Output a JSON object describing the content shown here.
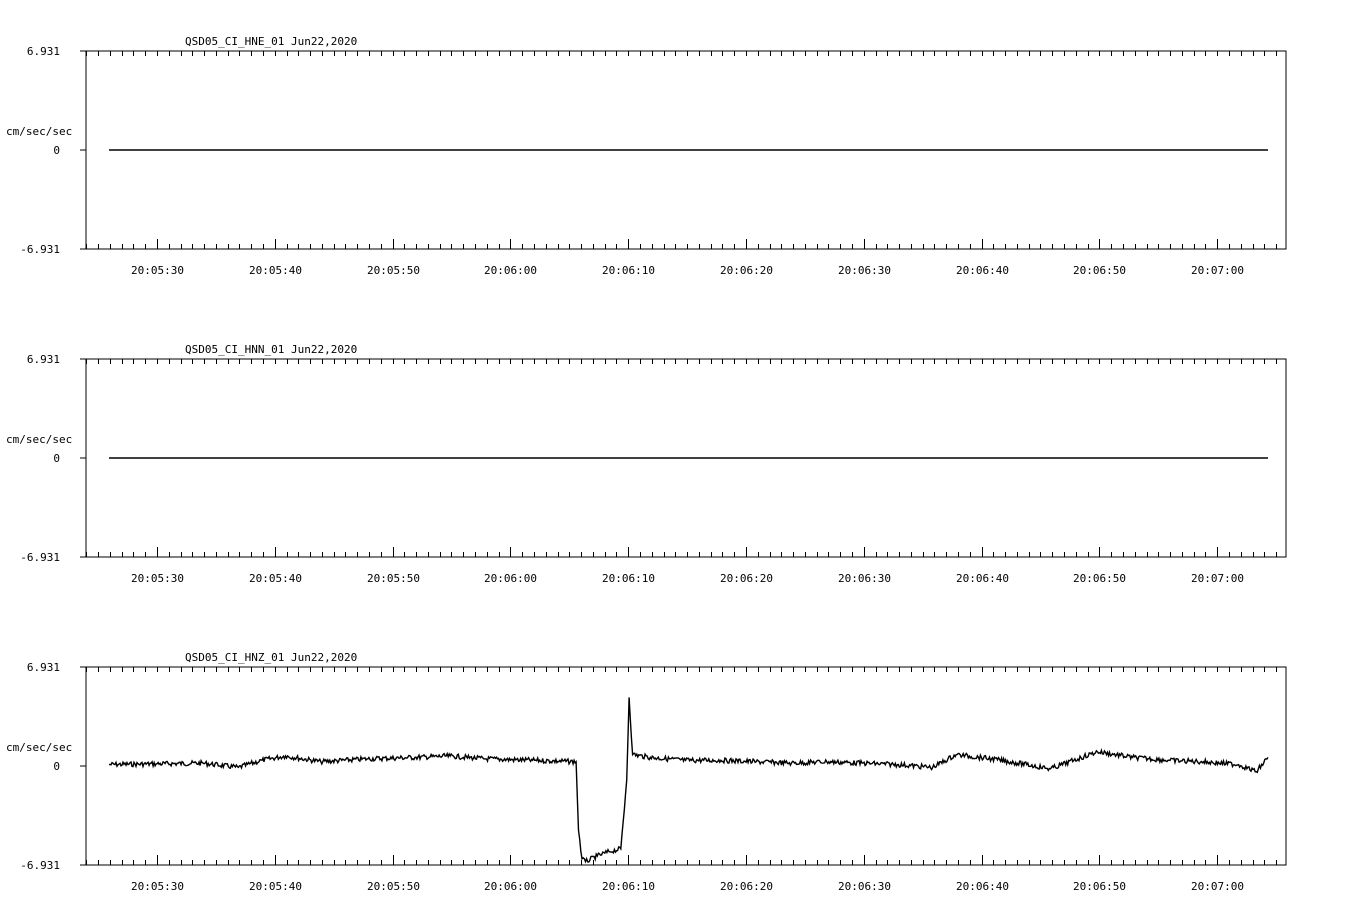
{
  "page": {
    "background": "#ffffff",
    "trace_color": "#000000"
  },
  "chart_data": [
    {
      "type": "line",
      "title": "QSD05_CI_HNE_01  Jun22,2020",
      "ylabel": "cm/sec/sec",
      "ylim": [
        -6.931,
        6.931
      ],
      "yticks": [
        "6.931",
        "0",
        "-6.931"
      ],
      "xlabels": [
        "20:05:30",
        "20:05:40",
        "20:05:50",
        "20:06:00",
        "20:06:10",
        "20:06:20",
        "20:06:30",
        "20:06:40",
        "20:06:50",
        "20:07:00"
      ],
      "x_start": "20:05:26",
      "x_end": "20:07:04.5",
      "grid": false,
      "series": [
        {
          "x": [
            "20:05:26",
            "20:07:04.5"
          ],
          "y": [
            0,
            0
          ]
        }
      ]
    },
    {
      "type": "line",
      "title": "QSD05_CI_HNN_01  Jun22,2020",
      "ylabel": "cm/sec/sec",
      "ylim": [
        -6.931,
        6.931
      ],
      "yticks": [
        "6.931",
        "0",
        "-6.931"
      ],
      "xlabels": [
        "20:05:30",
        "20:05:40",
        "20:05:50",
        "20:06:00",
        "20:06:10",
        "20:06:20",
        "20:06:30",
        "20:06:40",
        "20:06:50",
        "20:07:00"
      ],
      "x_start": "20:05:26",
      "x_end": "20:07:04.5",
      "grid": false,
      "series": [
        {
          "x": [
            "20:05:26",
            "20:07:04.5"
          ],
          "y": [
            0,
            0
          ]
        }
      ]
    },
    {
      "type": "line",
      "title": "QSD05_CI_HNZ_01  Jun22,2020",
      "ylabel": "cm/sec/sec",
      "ylim": [
        -6.931,
        6.931
      ],
      "yticks": [
        "6.931",
        "0",
        "-6.931"
      ],
      "xlabels": [
        "20:05:30",
        "20:05:40",
        "20:05:50",
        "20:06:00",
        "20:06:10",
        "20:06:20",
        "20:06:30",
        "20:06:40",
        "20:06:50",
        "20:07:00"
      ],
      "x_start": "20:05:26",
      "x_end": "20:07:04.5",
      "grid": false,
      "series": [
        {
          "x": [
            "20:05:26",
            "20:05:30",
            "20:05:34",
            "20:05:37",
            "20:05:39",
            "20:05:41",
            "20:05:44",
            "20:05:48",
            "20:05:52",
            "20:05:55",
            "20:05:58",
            "20:06:02",
            "20:06:05.7",
            "20:06:05.9",
            "20:06:06.2",
            "20:06:06.5",
            "20:06:07.5",
            "20:06:08.5",
            "20:06:09.5",
            "20:06:10",
            "20:06:10.2",
            "20:06:10.5",
            "20:06:12",
            "20:06:15",
            "20:06:18",
            "20:06:21",
            "20:06:24",
            "20:06:27",
            "20:06:30",
            "20:06:33",
            "20:06:36",
            "20:06:38",
            "20:06:41",
            "20:06:44",
            "20:06:46",
            "20:06:48",
            "20:06:50",
            "20:06:53",
            "20:06:56",
            "20:06:59",
            "20:07:02",
            "20:07:03.5",
            "20:07:04.5"
          ],
          "y": [
            0.1,
            0.15,
            0.2,
            -0.1,
            0.4,
            0.7,
            0.3,
            0.5,
            0.6,
            0.7,
            0.5,
            0.4,
            0.3,
            -4.5,
            -6.5,
            -6.7,
            -6.3,
            -6.0,
            -5.8,
            -1.0,
            4.8,
            0.8,
            0.6,
            0.4,
            0.4,
            0.3,
            0.2,
            0.3,
            0.2,
            0.1,
            -0.1,
            0.8,
            0.5,
            0.1,
            -0.2,
            0.4,
            1.0,
            0.6,
            0.4,
            0.3,
            0.1,
            -0.4,
            0.6
          ]
        }
      ]
    }
  ]
}
